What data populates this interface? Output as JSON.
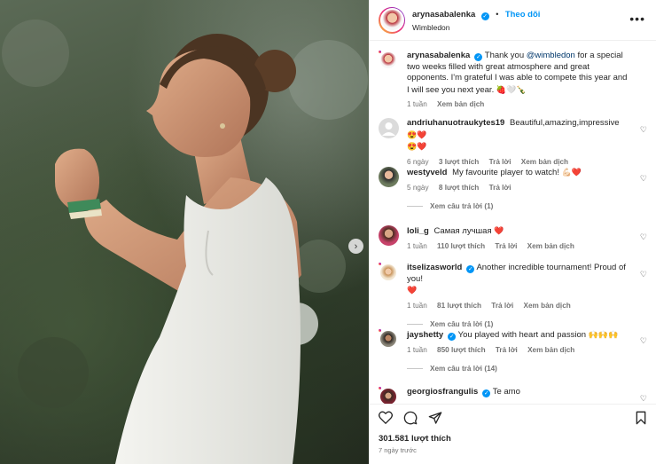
{
  "post": {
    "author": "arynasabalenka",
    "follow_label": "Theo dõi",
    "location": "Wimbledon",
    "caption_mention": "@wimbledon",
    "caption_before": "Thank you ",
    "caption_after": " for a special two weeks filled with great atmosphere and great opponents. I'm grateful I was able to compete this year and I will see you next year.",
    "caption_emoji": "🍓🤍🍾",
    "caption_time": "1 tuần",
    "caption_translate": "Xem bản dịch",
    "likes": "301.581 lượt thích",
    "date": "7 ngày trước"
  },
  "comments": [
    {
      "user": "andriuhanuotraukytes19",
      "verified": false,
      "text": "Beautiful,amazing,impressive",
      "emoji_inline": "😍❤️",
      "emoji_line2": "😍❤️",
      "time": "6 ngày",
      "likes": "3 lượt thích",
      "reply": "Trả lời",
      "translate": "Xem bản dịch"
    },
    {
      "user": "westyveld",
      "verified": false,
      "text": "My favourite player to watch!",
      "emoji_inline": "💪🏻❤️",
      "time": "5 ngày",
      "likes": "8 lượt thích",
      "reply": "Trả lời",
      "view_replies": "Xem câu trả lời (1)"
    },
    {
      "user": "loli_g",
      "verified": false,
      "text": "Самая лучшая",
      "emoji_inline": "❤️",
      "time": "1 tuần",
      "likes": "110 lượt thích",
      "reply": "Trả lời",
      "translate": "Xem bản dịch"
    },
    {
      "user": "itselizasworld",
      "verified": true,
      "text": "Another incredible tournament! Proud of you!",
      "emoji_line2": "❤️",
      "time": "1 tuần",
      "likes": "81 lượt thích",
      "reply": "Trả lời",
      "translate": "Xem bản dịch",
      "view_replies": "Xem câu trả lời (1)"
    },
    {
      "user": "jayshetty",
      "verified": true,
      "text": "You played with heart and passion",
      "emoji_inline": "🙌🙌🙌",
      "time": "1 tuần",
      "likes": "850 lượt thích",
      "reply": "Trả lời",
      "translate": "Xem bản dịch",
      "view_replies": "Xem câu trả lời (14)"
    },
    {
      "user": "georgiosfrangulis",
      "verified": true,
      "text": "Te amo"
    }
  ],
  "icons": {
    "more": "more-options-icon",
    "like": "heart-icon",
    "comment": "comment-icon",
    "share": "share-icon",
    "save": "bookmark-icon",
    "next": "chevron-right-icon"
  },
  "colors": {
    "accent": "#0095f6",
    "text": "#262626",
    "muted": "#737373"
  }
}
